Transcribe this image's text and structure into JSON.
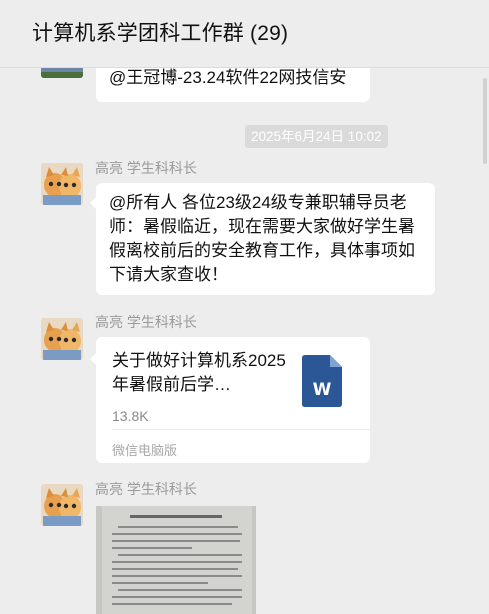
{
  "window": {
    "title": "计算机系学团科工作群 (29)"
  },
  "messages": {
    "partial_mention": "@王冠博-23.24软件22网技信安",
    "timestamp": "2025年6月24日 10:02",
    "msg1": {
      "sender": "高亮 学生科科长",
      "text": "@所有人 各位23级24级专兼职辅导员老师：暑假临近，现在需要大家做好学生暑假离校前后的安全教育工作，具体事项如下请大家查收！"
    },
    "msg2": {
      "sender": "高亮 学生科科长",
      "file_name": "关于做好计算机系2025年暑假前后学…",
      "file_size": "13.8K",
      "file_source": "微信电脑版",
      "file_icon": "word-doc-icon",
      "file_icon_letter": "W"
    },
    "msg3": {
      "sender": "高亮 学生科科长",
      "image": "document-photo"
    }
  },
  "colors": {
    "background": "#ededed",
    "bubble": "#ffffff",
    "word_blue": "#2b5797",
    "timestamp_bg": "#dadada"
  }
}
